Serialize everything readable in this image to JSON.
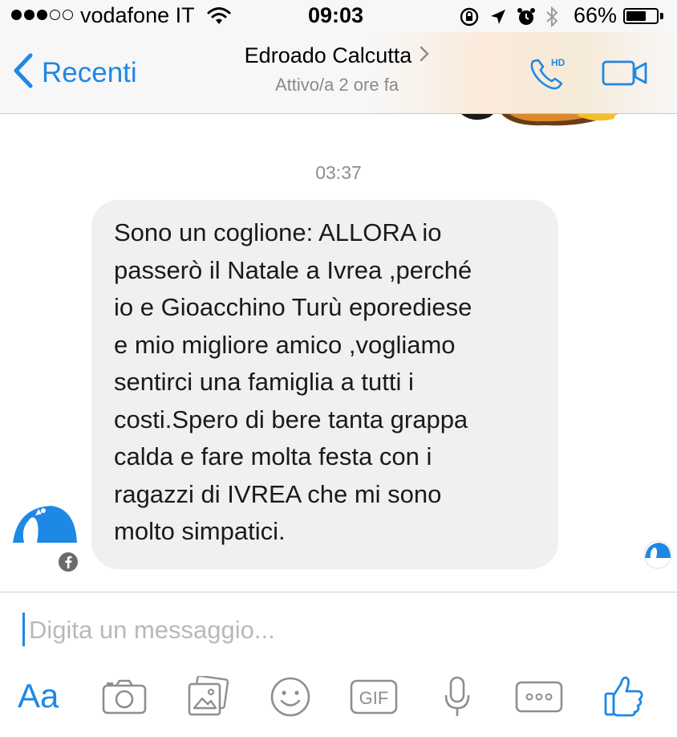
{
  "status_bar": {
    "carrier": "vodafone IT",
    "time": "09:03",
    "battery": "66%",
    "battery_level": 0.66,
    "signal_bars_filled": 3,
    "signal_bars_total": 5,
    "icons": [
      "wifi-icon",
      "rotation-lock-icon",
      "location-arrow-icon",
      "alarm-icon",
      "bluetooth-icon"
    ]
  },
  "header": {
    "back_label": "Recenti",
    "contact_name": "Edroado Calcutta",
    "contact_status": "Attivo/a 2 ore fa",
    "call_badge": "HD",
    "accent_color": "#1e88e5"
  },
  "chat": {
    "timestamp": "03:37",
    "message": {
      "text": "Sono un coglione: ALLORA io\npasserò il Natale a Ivrea ,perché\nio e Gioacchino Turù eporediese\ne mio migliore amico ,vogliamo\nsentirci una famiglia a tutti i\ncosti.Spero di bere tanta grappa\ncalda e fare molta festa con i\nragazzi di IVREA che mi sono\nmolto simpatici."
    }
  },
  "composer": {
    "placeholder": "Digita un messaggio..."
  },
  "toolbar": {
    "aa_label": "Aa",
    "gif_label": "GIF",
    "items": [
      "text-size-icon",
      "camera-icon",
      "photo-gallery-icon",
      "emoji-icon",
      "gif-icon",
      "microphone-icon",
      "more-icon",
      "like-icon"
    ]
  }
}
